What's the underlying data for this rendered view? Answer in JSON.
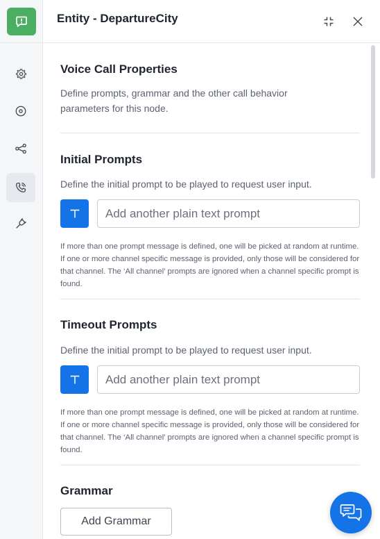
{
  "header": {
    "title": "Entity - DepartureCity"
  },
  "sidebar": {
    "items": [
      {
        "name": "settings",
        "icon": "gear-icon"
      },
      {
        "name": "target",
        "icon": "target-icon"
      },
      {
        "name": "connections",
        "icon": "share-nodes-icon"
      },
      {
        "name": "voice-call",
        "icon": "phone-icon",
        "active": true
      },
      {
        "name": "plug",
        "icon": "plug-icon"
      }
    ]
  },
  "main": {
    "voice_call": {
      "title": "Voice Call Properties",
      "description": "Define prompts, grammar and the other call behavior parameters for this node."
    },
    "initial_prompts": {
      "title": "Initial Prompts",
      "description": "Define the initial prompt to be played to request user input.",
      "button_label": "T",
      "placeholder": "Add another plain text prompt",
      "note": "If more than one prompt message is defined, one will be picked at random at runtime. If one or more channel specific message is provided, only those will be considered for that channel. The ‘All channel’ prompts are ignored when a channel specific prompt is found."
    },
    "timeout_prompts": {
      "title": "Timeout Prompts",
      "description": "Define the initial prompt to be played to request user input.",
      "button_label": "T",
      "placeholder": "Add another plain text prompt",
      "note": "If more than one prompt message is defined, one will be picked at random at runtime. If one or more channel specific message is provided, only those will be considered for that channel. The ‘All channel’ prompts are ignored when a channel specific prompt is found."
    },
    "grammar": {
      "title": "Grammar",
      "button_label": "Add Grammar"
    }
  },
  "colors": {
    "accent": "#1473e6",
    "node_badge": "#4cae63"
  }
}
